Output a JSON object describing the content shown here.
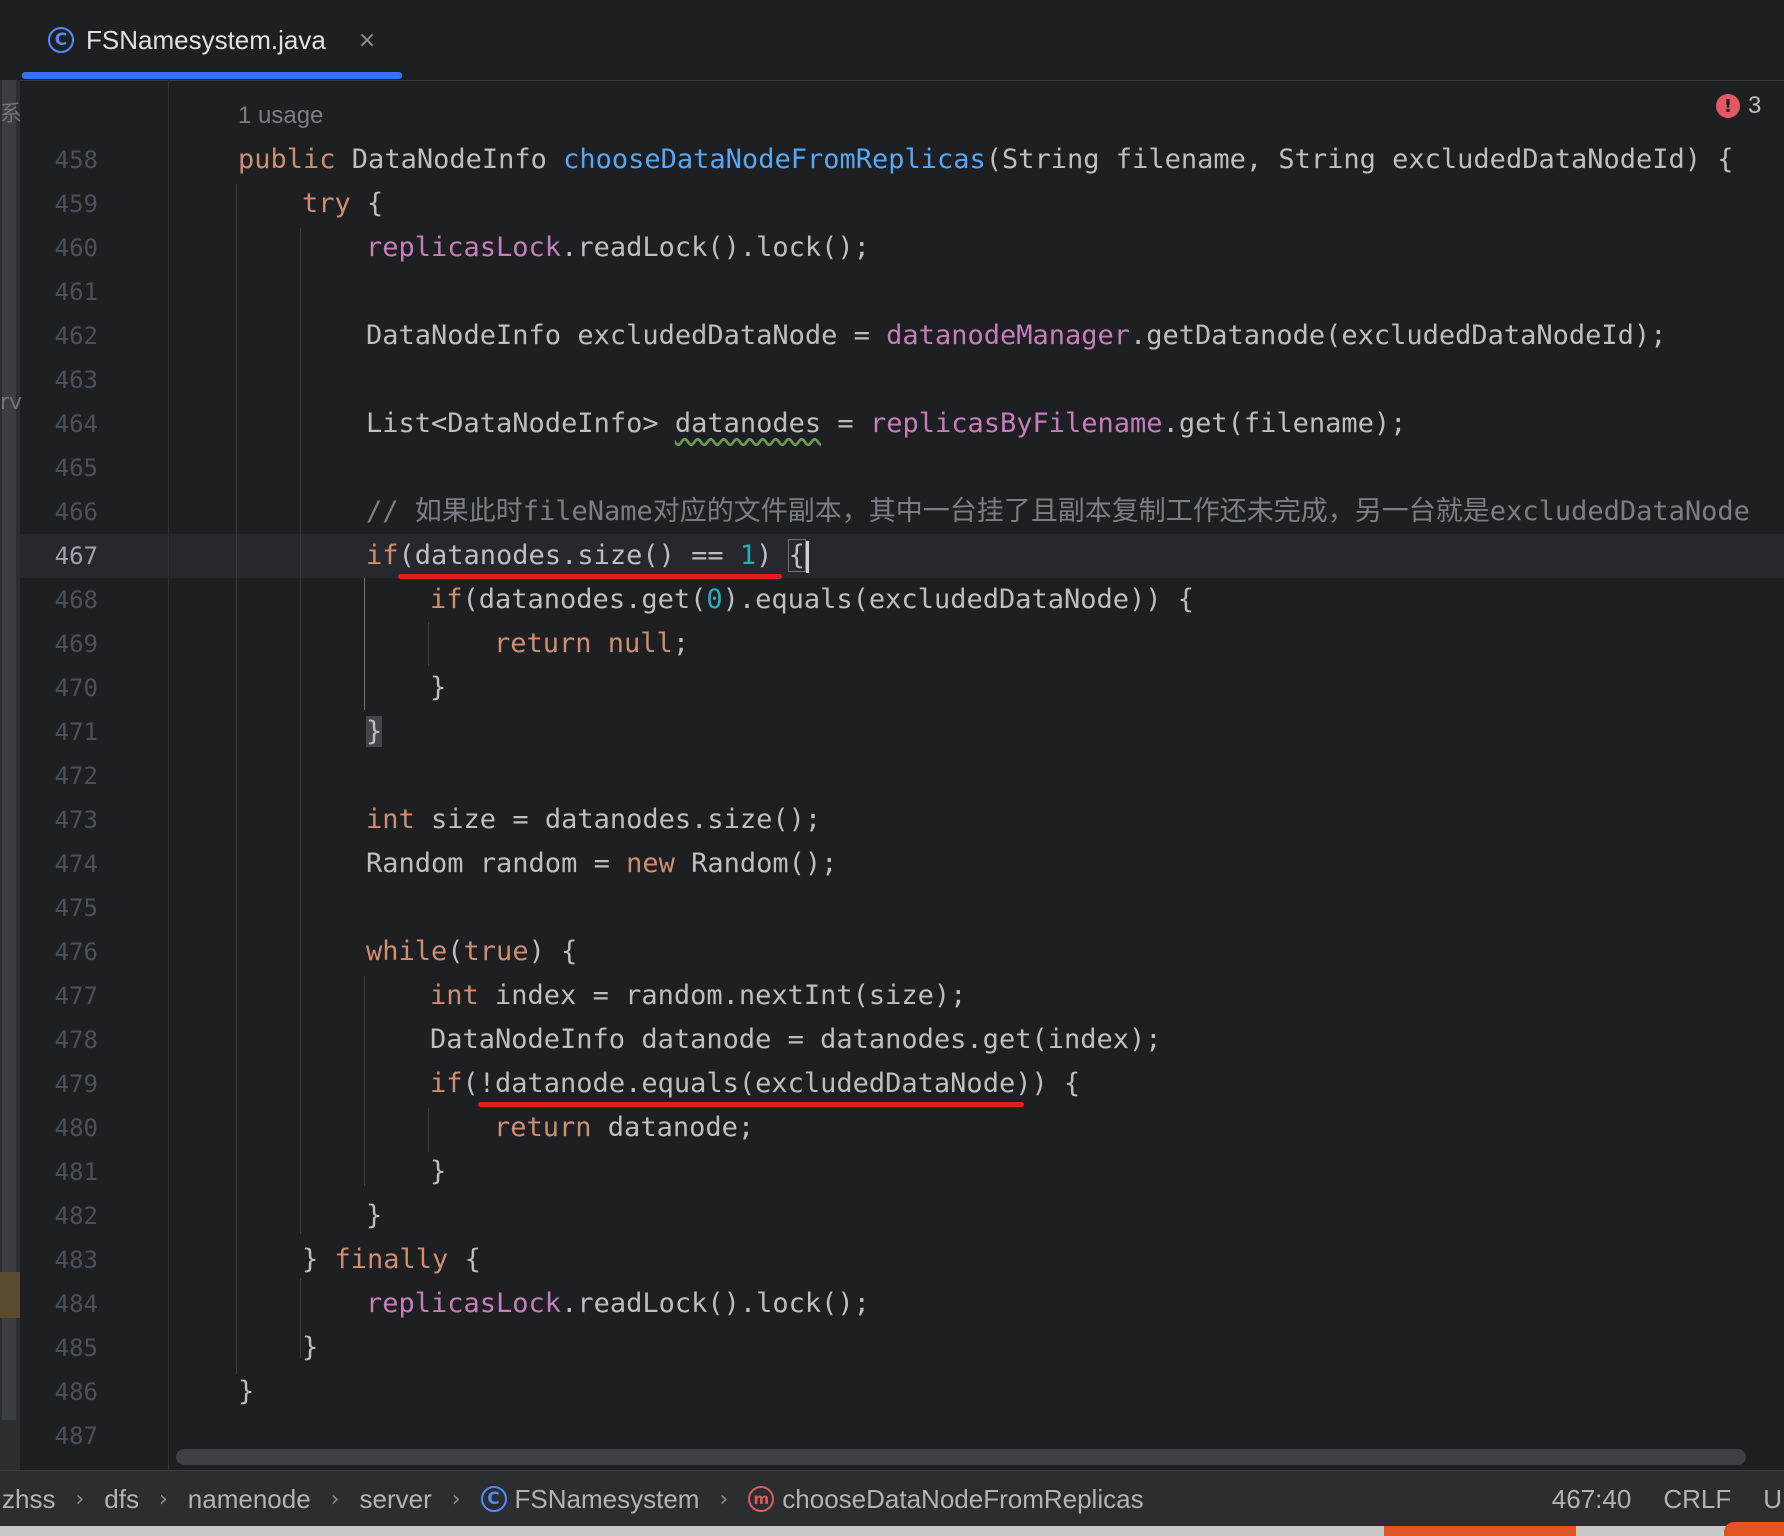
{
  "tab": {
    "title": "FSNamesystem.java",
    "icon": "class-icon",
    "close": "×"
  },
  "editor": {
    "usage_hint": "1 usage",
    "error_count": "3",
    "left_fragments": [
      "系",
      "rv"
    ],
    "line_numbers": [
      "458",
      "459",
      "460",
      "461",
      "462",
      "463",
      "464",
      "465",
      "466",
      "467",
      "468",
      "469",
      "470",
      "471",
      "472",
      "473",
      "474",
      "475",
      "476",
      "477",
      "478",
      "479",
      "480",
      "481",
      "482",
      "483",
      "484",
      "485",
      "486",
      "487"
    ],
    "current_line": "467",
    "code": {
      "l458": [
        "public",
        " DataNodeInfo ",
        "chooseDataNodeFromReplicas",
        "(String filename, String excludedDataNodeId) {"
      ],
      "l459": [
        "try",
        " {"
      ],
      "l460": [
        "replicasLock",
        ".readLock().lock();"
      ],
      "l462": [
        "DataNodeInfo excludedDataNode = ",
        "datanodeManager",
        ".getDatanode(excludedDataNodeId);"
      ],
      "l464": [
        "List<DataNodeInfo> ",
        "datanodes",
        " = ",
        "replicasByFilename",
        ".get(filename);"
      ],
      "l466": "// 如果此时fileName对应的文件副本，其中一台挂了且副本复制工作还未完成，另一台就是excludedDataNode",
      "l467": [
        "if",
        "(datanodes.size() == ",
        "1",
        ") ",
        "{"
      ],
      "l468": [
        "if",
        "(datanodes.get(",
        "0",
        ").equals(excludedDataNode)) {"
      ],
      "l469": [
        "return null",
        ";"
      ],
      "l470": "}",
      "l471": "}",
      "l473": [
        "int",
        " size = datanodes.size();"
      ],
      "l474": [
        "Random random = ",
        "new",
        " Random();"
      ],
      "l476": [
        "while",
        "(",
        "true",
        ") {"
      ],
      "l477": [
        "int",
        " index = random.nextInt(size);"
      ],
      "l478": "DataNodeInfo datanode = datanodes.get(index);",
      "l479": [
        "if",
        "(!datanode.equals(excludedDataNode)) {"
      ],
      "l480": [
        "return",
        " datanode;"
      ],
      "l481": "}",
      "l482": "}",
      "l483": [
        "} ",
        "finally",
        " {"
      ],
      "l484": [
        "replicasLock",
        ".readLock().lock();"
      ],
      "l485": "}",
      "l486": "}"
    }
  },
  "statusbar": {
    "breadcrumbs": [
      "zhss",
      "dfs",
      "namenode",
      "server",
      "FSNamesystem",
      "chooseDataNodeFromReplicas"
    ],
    "separator": "›",
    "cursor_position": "467:40",
    "line_ending": "CRLF",
    "encoding_fragment": "U"
  },
  "colors": {
    "background": "#1e1f22",
    "keyword": "#cf8e6d",
    "function": "#56a8f5",
    "field": "#c77dbb",
    "number": "#2aacb8",
    "comment": "#7a7e85",
    "annotation_red": "#e31b23",
    "tab_accent": "#3574f0"
  }
}
